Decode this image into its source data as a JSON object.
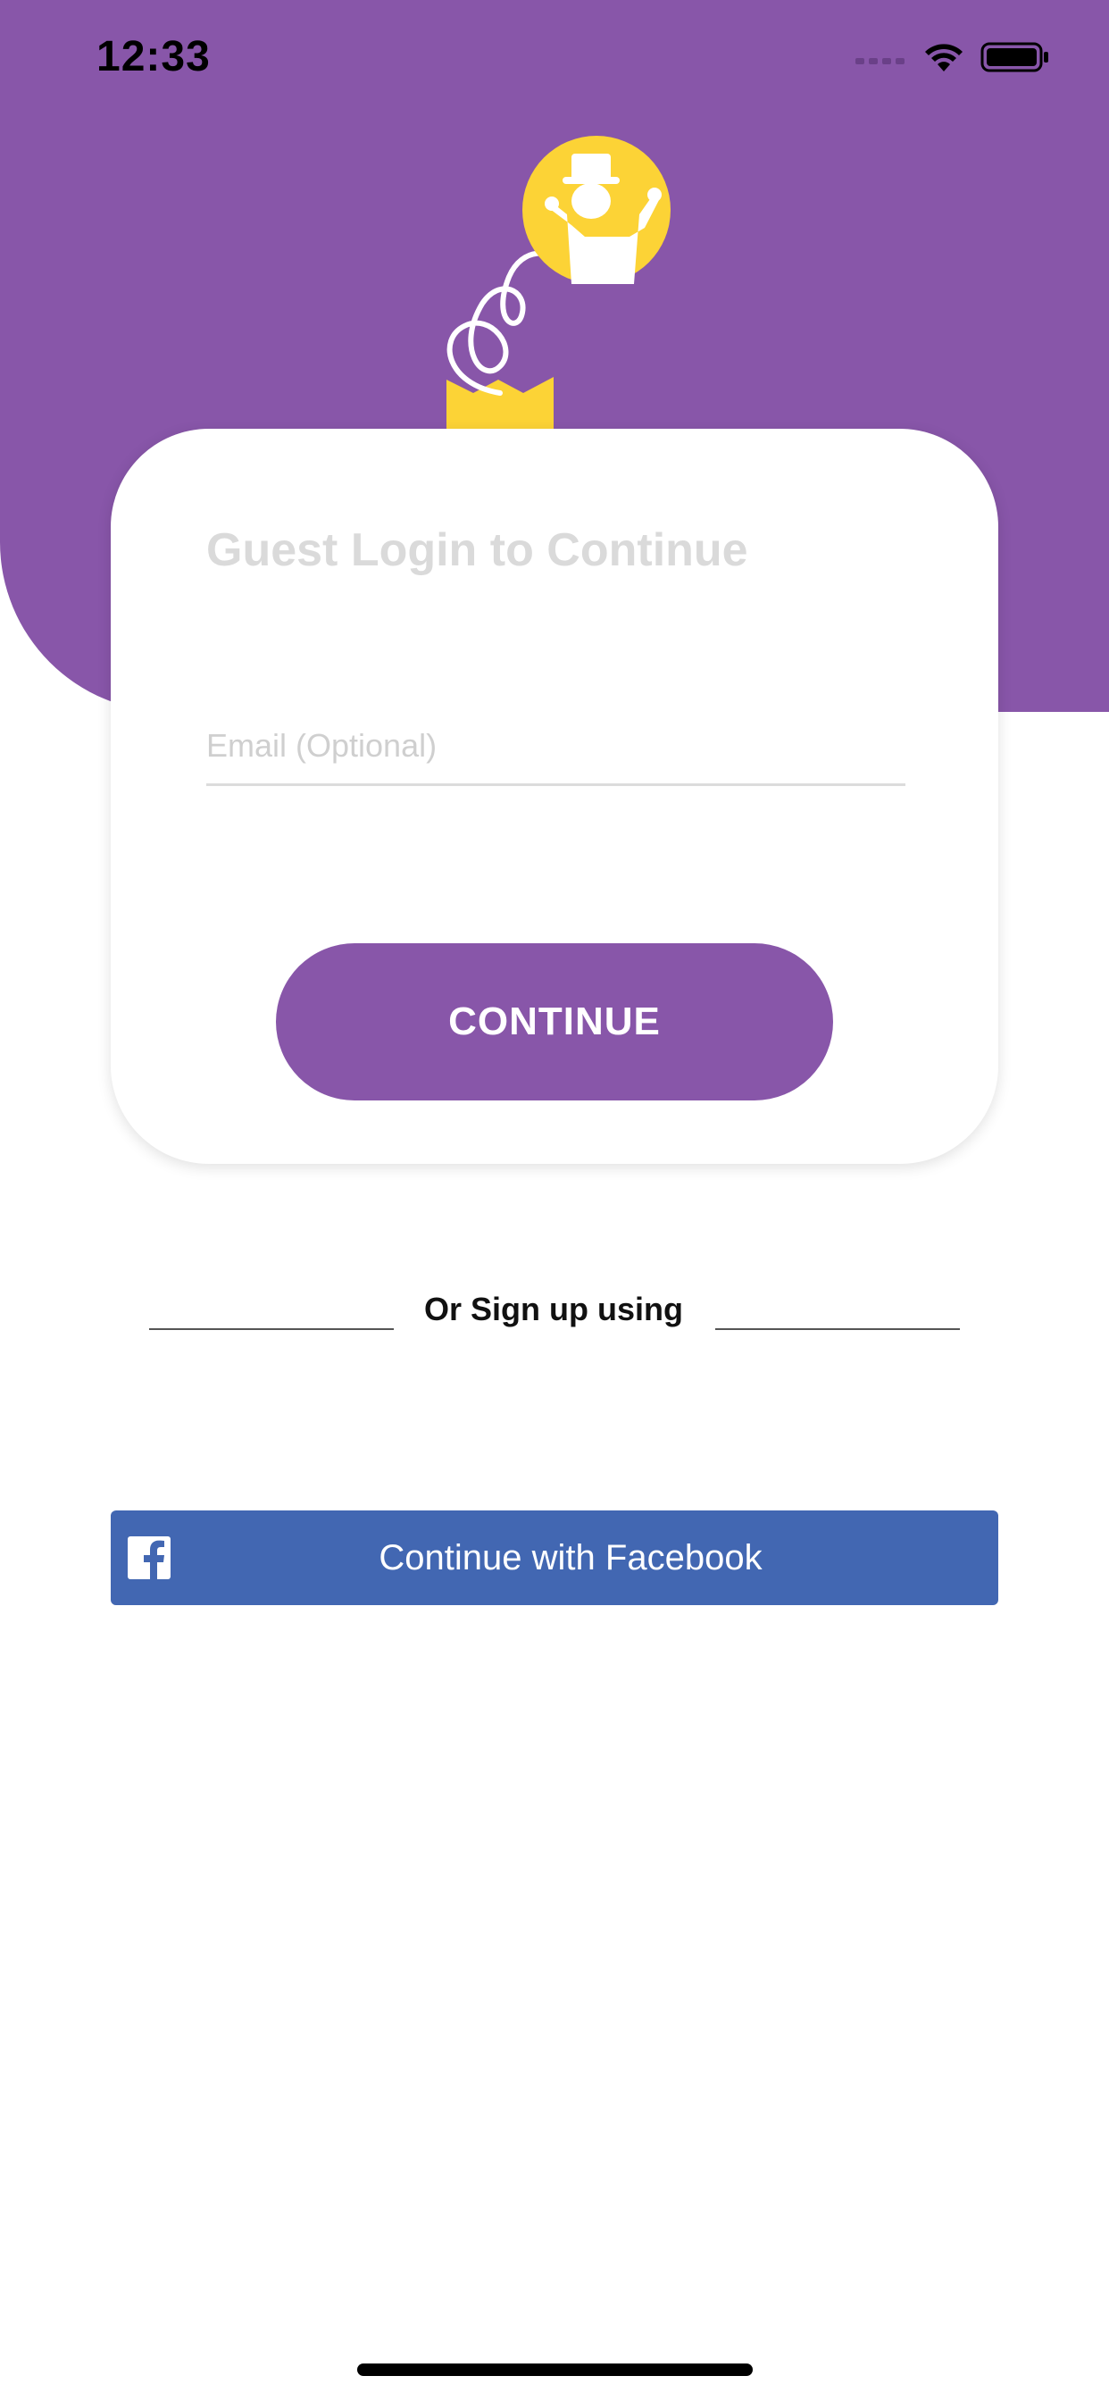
{
  "status_bar": {
    "time": "12:33",
    "icons": [
      "cellular-signal-icon",
      "wifi-icon",
      "battery-icon"
    ]
  },
  "header": {
    "mascot_icon": "jack-in-the-box-mascot-icon"
  },
  "login_card": {
    "title": "Guest Login to Continue",
    "email": {
      "placeholder": "Email (Optional)",
      "value": ""
    },
    "continue_label": "CONTINUE"
  },
  "divider": {
    "text": "Or Sign up using"
  },
  "social": {
    "facebook_label": "Continue with Facebook",
    "facebook_icon": "facebook-icon"
  },
  "colors": {
    "brand_purple": "#8856a9",
    "mascot_yellow": "#fcd336",
    "facebook_blue": "#4267b2",
    "title_gray": "#dadada"
  }
}
